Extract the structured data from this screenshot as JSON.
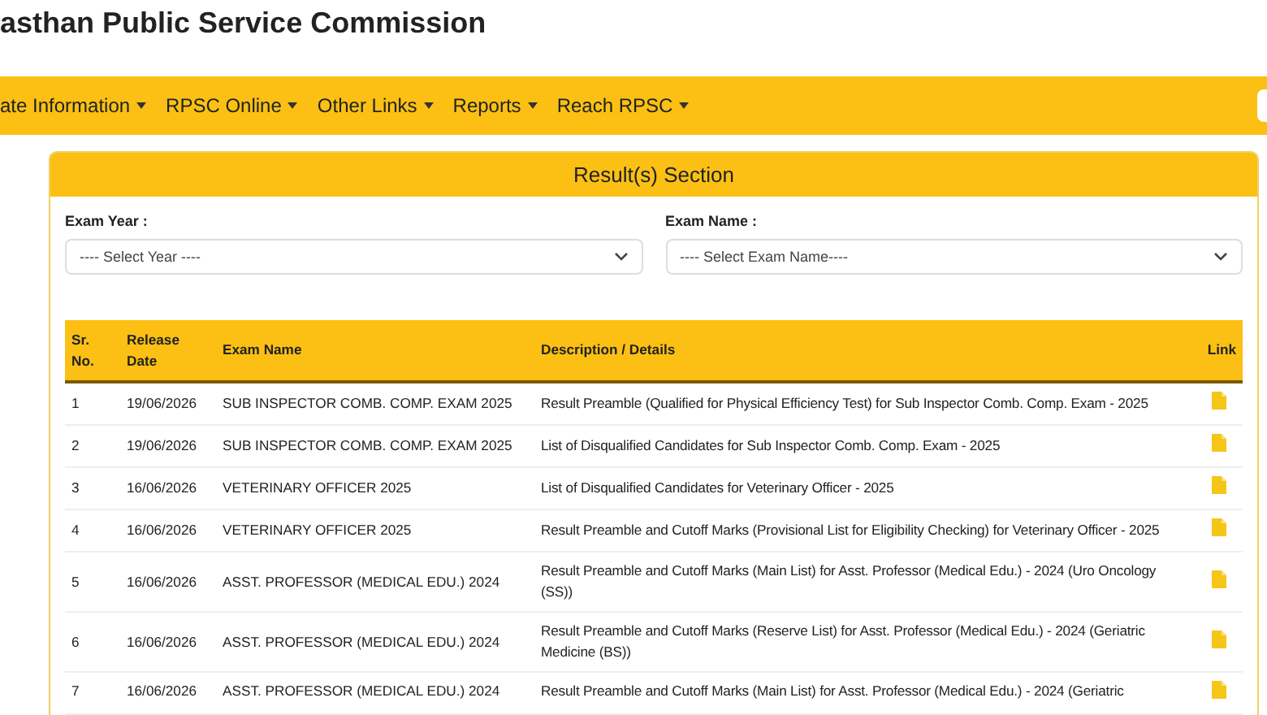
{
  "header": {
    "title": "asthan Public Service Commission"
  },
  "nav": [
    {
      "label": "ate Information"
    },
    {
      "label": "RPSC Online"
    },
    {
      "label": "Other Links"
    },
    {
      "label": "Reports"
    },
    {
      "label": "Reach RPSC"
    }
  ],
  "panel": {
    "title": "Result(s) Section",
    "filters": [
      {
        "label": "Exam Year :",
        "value": "---- Select Year ----"
      },
      {
        "label": "Exam Name :",
        "value": "---- Select Exam Name----"
      }
    ],
    "table": {
      "columns": [
        "Sr. No.",
        "Release Date",
        "Exam Name",
        "Description / Details",
        "Link"
      ],
      "rows": [
        {
          "cells": [
            "1",
            "19/06/2026",
            "SUB INSPECTOR COMB. COMP. EXAM 2025",
            "Result Preamble (Qualified for Physical Efficiency Test) for Sub Inspector Comb. Comp. Exam - 2025"
          ]
        },
        {
          "cells": [
            "2",
            "19/06/2026",
            "SUB INSPECTOR COMB. COMP. EXAM 2025",
            "List of Disqualified Candidates for Sub Inspector Comb. Comp. Exam - 2025"
          ]
        },
        {
          "cells": [
            "3",
            "16/06/2026",
            "VETERINARY OFFICER 2025",
            "List of Disqualified Candidates for Veterinary Officer - 2025"
          ]
        },
        {
          "cells": [
            "4",
            "16/06/2026",
            "VETERINARY OFFICER 2025",
            "Result Preamble and Cutoff Marks (Provisional List for Eligibility Checking) for Veterinary Officer - 2025"
          ]
        },
        {
          "cells": [
            "5",
            "16/06/2026",
            "ASST. PROFESSOR (MEDICAL EDU.) 2024",
            "Result Preamble and Cutoff Marks (Main List) for Asst. Professor (Medical Edu.) - 2024 (Uro Oncology (SS))"
          ]
        },
        {
          "cells": [
            "6",
            "16/06/2026",
            "ASST. PROFESSOR (MEDICAL EDU.) 2024",
            "Result Preamble and Cutoff Marks (Reserve List) for Asst. Professor (Medical Edu.) - 2024 (Geriatric Medicine (BS))"
          ]
        },
        {
          "cells": [
            "7",
            "16/06/2026",
            "ASST. PROFESSOR (MEDICAL EDU.) 2024",
            "Result Preamble and Cutoff Marks (Main List) for Asst. Professor (Medical Edu.) - 2024 (Geriatric"
          ]
        }
      ]
    }
  }
}
